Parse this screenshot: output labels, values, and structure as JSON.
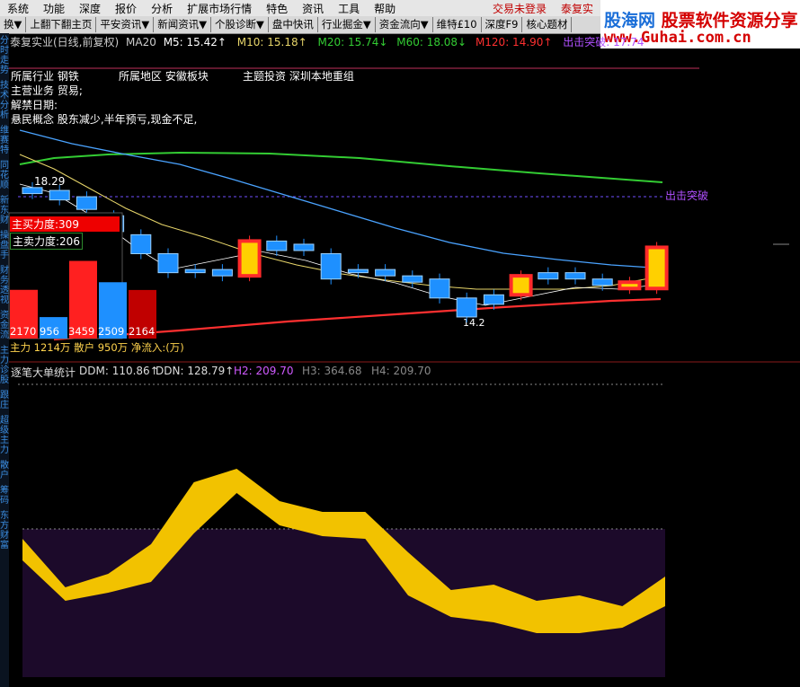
{
  "menu": [
    "系统",
    "功能",
    "深度",
    "报价",
    "分析",
    "扩展市场行情",
    "特色",
    "资讯",
    "工具",
    "帮助"
  ],
  "menu_right": [
    "交易未登录",
    "泰复实"
  ],
  "toolbar": [
    "换▼",
    "上翻下翻主页",
    "平安资讯▼",
    "新闻资讯▼",
    "个股诊断▼",
    "盘中快讯",
    "行业掘金▼",
    "资金流向▼",
    "维特£10",
    "深度F9",
    "核心题材"
  ],
  "logo": {
    "part1": "股海网",
    "part2": "股票软件资源分享",
    "url": "www.Guhai.com.cn"
  },
  "side_tabs": [
    "分时走势",
    "技术分析",
    "维赛特",
    "同花顺",
    "新东财",
    "操盘手",
    "财务透视",
    "资金流",
    "主力诊股",
    "跟庄",
    "超级主力",
    "散户",
    "筹码",
    "东方财富"
  ],
  "header": {
    "name": "泰复实业(日线,前复权)",
    "ma20": "MA20",
    "m5": "M5: 15.42↑",
    "m10": "M10: 15.18↑",
    "m20": "M20: 15.74↓",
    "m60": "M60: 18.08↓",
    "m120": "M120: 14.90↑",
    "break": "出击突破: 17.74"
  },
  "info": {
    "industry": "所属行业 钢铁",
    "region": "所属地区 安徽板块",
    "theme": "主题投资 深圳本地重组",
    "business": "主营业务 贸易;",
    "unlock": "解禁日期:",
    "risk": "悬民概念 股东减少,半年预亏,现金不足,"
  },
  "labels": {
    "price_high": "18.29",
    "price_low": "14.2",
    "break_label": "出击突破"
  },
  "force": {
    "buy_label": "主买力度:309",
    "sell_label": "主卖力度:206",
    "v1": "2170",
    "v2": "956",
    "v3": "3459",
    "v4": "2509",
    "v5": "2164",
    "footer": "主力 1214万 散户 950万 净流入:(万)"
  },
  "indicator": {
    "title": "逐笔大单统计",
    "ddm": "DDM: 110.86↑",
    "ddn": "DDN: 128.79↑",
    "h2": "H2: 209.70",
    "h3": "H3: 364.68",
    "h4": "H4: 209.70"
  },
  "colors": {
    "up": "#ff2a2a",
    "down": "#1e90ff",
    "ma5": "#ffffff",
    "ma10": "#e8d66a",
    "ma20": "#33cc33",
    "ma60": "#4aa3ff",
    "ma120": "#ff3030",
    "area": "#1c0a2a",
    "yellow": "#f2c200"
  },
  "chart_data": {
    "type": "candlestick",
    "candles": [
      {
        "o": 18.29,
        "c": 18.1
      },
      {
        "o": 18.2,
        "c": 17.9
      },
      {
        "o": 18.0,
        "c": 17.6
      },
      {
        "o": 17.4,
        "c": 16.9
      },
      {
        "o": 16.8,
        "c": 16.2
      },
      {
        "o": 16.2,
        "c": 15.6
      },
      {
        "o": 15.7,
        "c": 15.6
      },
      {
        "o": 15.7,
        "c": 15.5
      },
      {
        "o": 15.5,
        "c": 16.6
      },
      {
        "o": 16.6,
        "c": 16.3
      },
      {
        "o": 16.5,
        "c": 16.3
      },
      {
        "o": 16.2,
        "c": 15.4
      },
      {
        "o": 15.7,
        "c": 15.6
      },
      {
        "o": 15.7,
        "c": 15.5
      },
      {
        "o": 15.5,
        "c": 15.3
      },
      {
        "o": 15.4,
        "c": 14.8
      },
      {
        "o": 14.8,
        "c": 14.2
      },
      {
        "o": 14.9,
        "c": 14.6
      },
      {
        "o": 14.9,
        "c": 15.5
      },
      {
        "o": 15.6,
        "c": 15.4
      },
      {
        "o": 15.6,
        "c": 15.4
      },
      {
        "o": 15.4,
        "c": 15.2
      },
      {
        "o": 15.1,
        "c": 15.3
      },
      {
        "o": 15.1,
        "c": 16.4
      }
    ],
    "force_bars": [
      2170,
      956,
      3459,
      2509,
      2164
    ],
    "ddm_band": {
      "top": [
        2.0,
        1.1,
        1.35,
        1.9,
        3.05,
        3.3,
        2.7,
        2.5,
        2.5,
        1.75,
        1.05,
        1.15,
        0.85,
        0.95,
        0.75,
        1.3
      ],
      "bottom": [
        1.6,
        0.85,
        1.0,
        1.2,
        2.1,
        2.85,
        2.25,
        2.05,
        2.0,
        0.95,
        0.55,
        0.45,
        0.25,
        0.25,
        0.35,
        0.75
      ]
    }
  }
}
